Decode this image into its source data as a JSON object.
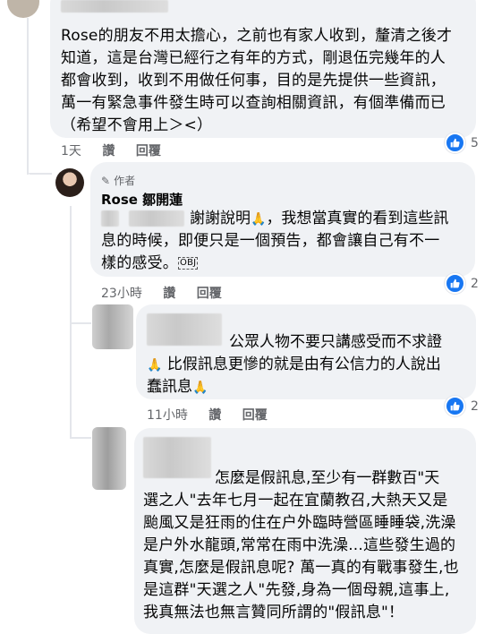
{
  "comment1": {
    "text": "Rose的朋友不用太擔心，之前也有家人收到，釐清之後才\n知道，這是台灣已經行之有年的方式，剛退伍完幾年的人\n都會收到，收到不用做任何事，目的是先提供一些資訊，\n萬一有緊急事件發生時可以查詢相關資訊，有個準備而已\n（希望不會用上＞<）",
    "time": "1天",
    "like": "讚",
    "reply": "回覆",
    "reaction_count": "5"
  },
  "comment2": {
    "badge": "作者",
    "author": "Rose 鄒開蓮",
    "line1": "謝謝說明",
    "line1b": "，我想當真實的看到這些訊",
    "text_rest": "息的時候，即便只是一個預告，都會讓自己有不一\n樣的感受。",
    "emoji": "OBJ",
    "time": "23小時",
    "like": "讚",
    "reply": "回覆",
    "reaction_count": "2"
  },
  "comment3": {
    "line1": "公眾人物不要只講感受而不求證",
    "line2": "比假訊息更慘的就是由有公信力的人說出",
    "line3": "蠢訊息",
    "time": "11小時",
    "like": "讚",
    "reply": "回覆",
    "reaction_count": "2"
  },
  "comment4": {
    "line1": "怎麼是假訊息,至少有一群數百\"天",
    "text_rest": "選之人\"去年七月一起在宜蘭教召,大熱天又是\n颱風又是狂雨的住在户外臨時營區睡睡袋,洗澡\n是户外水龍頭,常常在雨中洗澡...這些發生過的\n真實,怎麼是假訊息呢? 萬一真的有戰事發生,也\n是這群\"天選之人\"先發,身為一個母親,這事上,\n我真無法也無言贊同所謂的\"假訊息\"！"
  },
  "colors": {
    "bubble": "#f0f2f5",
    "like_blue": "#1877f2",
    "meta": "#65676b"
  }
}
